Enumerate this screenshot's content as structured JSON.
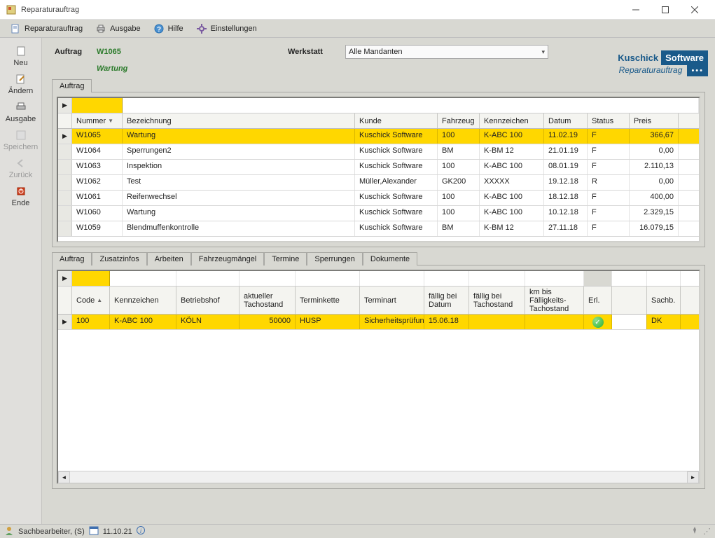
{
  "window": {
    "title": "Reparaturauftrag"
  },
  "menu": {
    "reparaturauftrag": "Reparaturauftrag",
    "ausgabe": "Ausgabe",
    "hilfe": "Hilfe",
    "einstellungen": "Einstellungen"
  },
  "sidebar": {
    "neu": "Neu",
    "aendern": "Ändern",
    "ausgabe": "Ausgabe",
    "speichern": "Speichern",
    "zurueck": "Zurück",
    "ende": "Ende"
  },
  "header": {
    "auftrag_label": "Auftrag",
    "auftrag_value": "W1065",
    "auftrag_sub": "Wartung",
    "werkstatt_label": "Werkstatt",
    "werkstatt_value": "Alle Mandanten"
  },
  "brand": {
    "kuschick": "Kuschick",
    "software": "Software",
    "subtitle": "Reparaturauftrag",
    "dots": "•••"
  },
  "upper": {
    "tab": "Auftrag",
    "cols": {
      "nummer": "Nummer",
      "bezeichnung": "Bezeichnung",
      "kunde": "Kunde",
      "fahrzeug": "Fahrzeug",
      "kennzeichen": "Kennzeichen",
      "datum": "Datum",
      "status": "Status",
      "preis": "Preis"
    },
    "rows": [
      {
        "num": "W1065",
        "bez": "Wartung",
        "kunde": "Kuschick Software",
        "fahr": "100",
        "kenn": "K-ABC 100",
        "datum": "11.02.19",
        "stat": "F",
        "preis": "366,67",
        "sel": true
      },
      {
        "num": "W1064",
        "bez": "Sperrungen2",
        "kunde": "Kuschick Software",
        "fahr": "BM",
        "kenn": "K-BM 12",
        "datum": "21.01.19",
        "stat": "F",
        "preis": "0,00"
      },
      {
        "num": "W1063",
        "bez": "Inspektion",
        "kunde": "Kuschick Software",
        "fahr": "100",
        "kenn": "K-ABC 100",
        "datum": "08.01.19",
        "stat": "F",
        "preis": "2.110,13"
      },
      {
        "num": "W1062",
        "bez": "Test",
        "kunde": "Müller,Alexander",
        "fahr": "GK200",
        "kenn": "XXXXX",
        "datum": "19.12.18",
        "stat": "R",
        "preis": "0,00"
      },
      {
        "num": "W1061",
        "bez": "Reifenwechsel",
        "kunde": "Kuschick Software",
        "fahr": "100",
        "kenn": "K-ABC 100",
        "datum": "18.12.18",
        "stat": "F",
        "preis": "400,00"
      },
      {
        "num": "W1060",
        "bez": "Wartung",
        "kunde": "Kuschick Software",
        "fahr": "100",
        "kenn": "K-ABC 100",
        "datum": "10.12.18",
        "stat": "F",
        "preis": "2.329,15"
      },
      {
        "num": "W1059",
        "bez": "Blendmuffenkontrolle",
        "kunde": "Kuschick Software",
        "fahr": "BM",
        "kenn": "K-BM 12",
        "datum": "27.11.18",
        "stat": "F",
        "preis": "16.079,15"
      }
    ]
  },
  "lower": {
    "tabs": {
      "auftrag": "Auftrag",
      "zusatzinfos": "Zusatzinfos",
      "arbeiten": "Arbeiten",
      "fahrzeugmaengel": "Fahrzeugmängel",
      "termine": "Termine",
      "sperrungen": "Sperrungen",
      "dokumente": "Dokumente"
    },
    "cols": {
      "code": "Code",
      "kennzeichen": "Kennzeichen",
      "betriebshof": "Betriebshof",
      "akt_tacho": "aktueller Tachostand",
      "terminkette": "Terminkette",
      "terminart": "Terminart",
      "faellig_datum": "fällig bei Datum",
      "faellig_tacho": "fällig bei Tachostand",
      "km_bis": "km bis Fälligkeits-Tachostand",
      "erl": "Erl.",
      "sachb": "Sachb."
    },
    "rows": [
      {
        "code": "100",
        "kenn": "K-ABC 100",
        "bhof": "KÖLN",
        "tacho": "50000",
        "tkette": "HUSP",
        "tart": "Sicherheitsprüfung",
        "fdatum": "15.06.18",
        "ftacho": "",
        "kmfall": "",
        "erl": true,
        "sachb": "DK",
        "sel": true
      }
    ]
  },
  "statusbar": {
    "user": "Sachbearbeiter, (S)",
    "date": "11.10.21"
  }
}
